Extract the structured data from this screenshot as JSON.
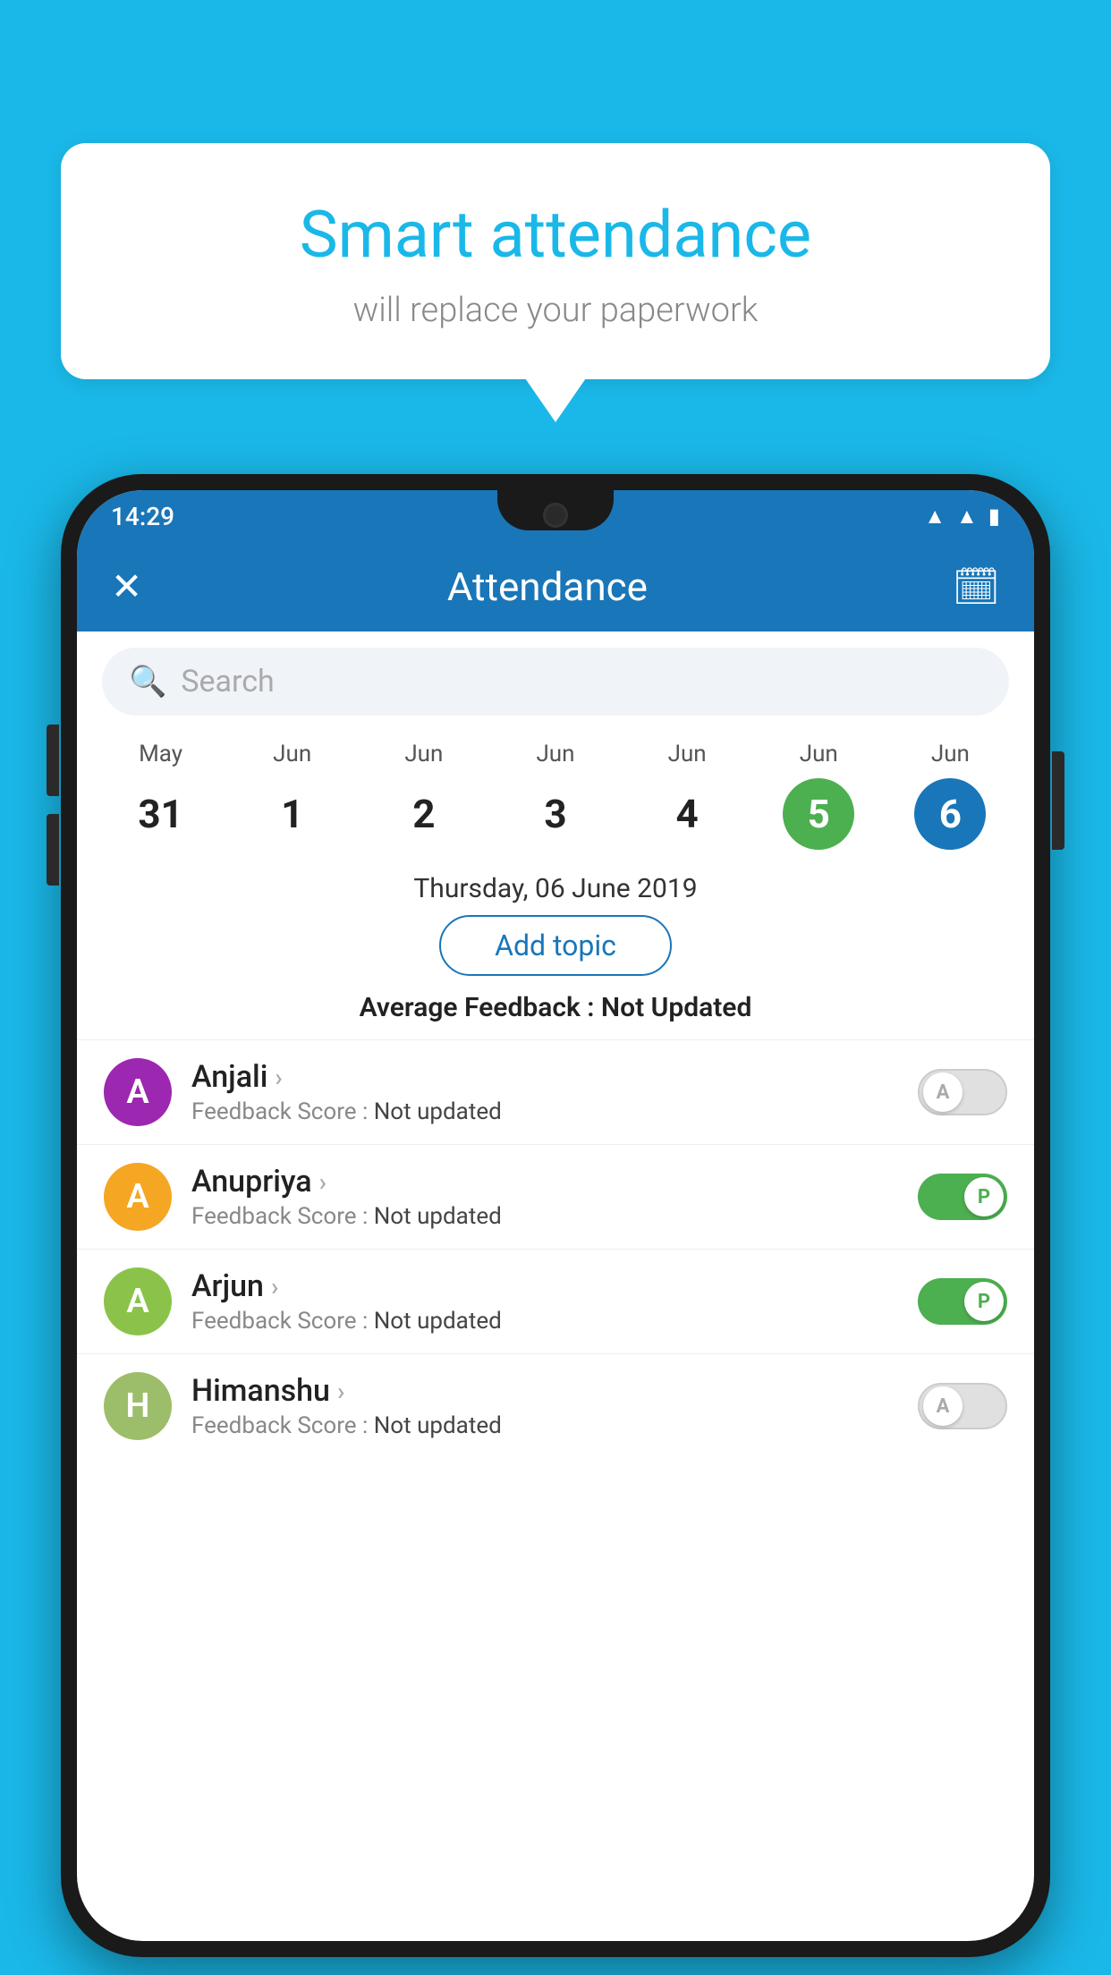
{
  "background_color": "#1ab8e8",
  "speech_bubble": {
    "title": "Smart attendance",
    "subtitle": "will replace your paperwork"
  },
  "status_bar": {
    "time": "14:29",
    "icons": [
      "wifi",
      "signal",
      "battery"
    ]
  },
  "app_bar": {
    "title": "Attendance",
    "close_icon": "✕",
    "calendar_icon": "📅"
  },
  "search": {
    "placeholder": "Search"
  },
  "calendar": {
    "days": [
      {
        "month": "May",
        "date": "31",
        "state": "normal"
      },
      {
        "month": "Jun",
        "date": "1",
        "state": "normal"
      },
      {
        "month": "Jun",
        "date": "2",
        "state": "normal"
      },
      {
        "month": "Jun",
        "date": "3",
        "state": "normal"
      },
      {
        "month": "Jun",
        "date": "4",
        "state": "normal"
      },
      {
        "month": "Jun",
        "date": "5",
        "state": "today"
      },
      {
        "month": "Jun",
        "date": "6",
        "state": "selected"
      }
    ],
    "selected_date_text": "Thursday, 06 June 2019"
  },
  "add_topic_label": "Add topic",
  "average_feedback": {
    "label": "Average Feedback : ",
    "value": "Not Updated"
  },
  "students": [
    {
      "name": "Anjali",
      "avatar_letter": "A",
      "avatar_color": "#9c27b0",
      "feedback_label": "Feedback Score : ",
      "feedback_value": "Not updated",
      "toggle_state": "off",
      "toggle_label": "A"
    },
    {
      "name": "Anupriya",
      "avatar_letter": "A",
      "avatar_color": "#f5a623",
      "feedback_label": "Feedback Score : ",
      "feedback_value": "Not updated",
      "toggle_state": "on",
      "toggle_label": "P"
    },
    {
      "name": "Arjun",
      "avatar_letter": "A",
      "avatar_color": "#8bc34a",
      "feedback_label": "Feedback Score : ",
      "feedback_value": "Not updated",
      "toggle_state": "on",
      "toggle_label": "P"
    },
    {
      "name": "Himanshu",
      "avatar_letter": "H",
      "avatar_color": "#9cbe6a",
      "feedback_label": "Feedback Score : ",
      "feedback_value": "Not updated",
      "toggle_state": "off",
      "toggle_label": "A"
    }
  ]
}
